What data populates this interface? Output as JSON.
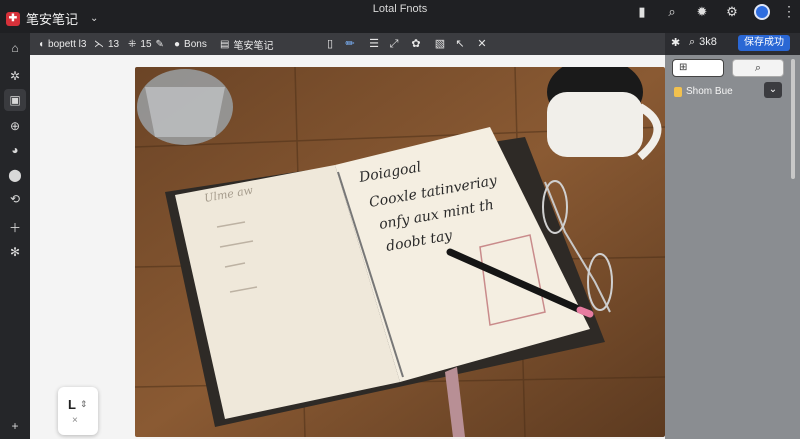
{
  "app": {
    "name": "笔安笔记",
    "window_title": "Lotal Fnots",
    "logo_icon": "app-logo-icon",
    "accent_color": "#d6313a"
  },
  "titlebar_icons": [
    "pin-icon",
    "search-icon",
    "settings-icon",
    "gear-icon",
    "avatar"
  ],
  "sidebar": {
    "items": [
      "home-icon",
      "share-icon",
      "notes-icon",
      "add-circle-icon",
      "stats-icon",
      "location-icon",
      "sync-icon",
      "add-icon",
      "settings-icon"
    ],
    "bottom_add": "+"
  },
  "toolbar": {
    "tab1": "bopett l3",
    "tab2_count": "13",
    "tab3_count": "15",
    "tab4": "Bons",
    "tab5": "笔安笔记"
  },
  "right_toolbar": {
    "search_label": "3k8",
    "action_button": "保存成功"
  },
  "side_panel": {
    "field_value": "",
    "item_label": "Shom Bue"
  },
  "floating_card": {
    "label": "L",
    "sub": "⇕",
    "close": "×"
  },
  "photo": {
    "left_page_text": [
      "Ulme aw"
    ],
    "right_page_text": [
      "Doiagoal",
      "Cooxle tatinveriay",
      "onfy aux mint th",
      "doobt tay"
    ]
  }
}
